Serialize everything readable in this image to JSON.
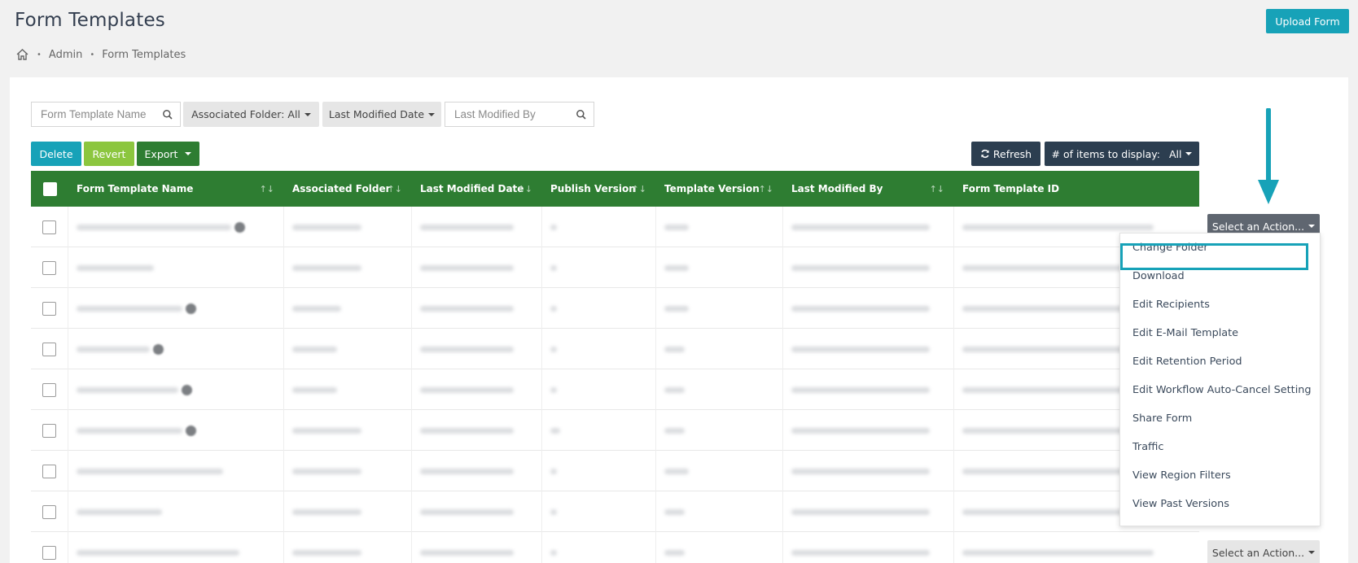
{
  "header": {
    "title": "Form Templates",
    "upload_label": "Upload Form",
    "breadcrumb": [
      "Admin",
      "Form Templates"
    ]
  },
  "filters": {
    "name_placeholder": "Form Template Name",
    "folder_label": "Associated Folder: All",
    "date_label": "Last Modified Date",
    "modified_by_placeholder": "Last Modified By"
  },
  "toolbar": {
    "delete_label": "Delete",
    "revert_label": "Revert",
    "export_label": "Export",
    "refresh_label": "Refresh",
    "items_label": "# of items to display:",
    "items_value": "All"
  },
  "table": {
    "columns": [
      "Form Template Name",
      "Associated Folder",
      "Last Modified Date",
      "Publish Version",
      "Template Version",
      "Last Modified By",
      "Form Template ID"
    ],
    "row_count": 9
  },
  "row_actions": {
    "button_label": "Select an Action...",
    "menu": [
      "Change Folder",
      "Download",
      "Edit Recipients",
      "Edit E-Mail Template",
      "Edit Retention Period",
      "Edit Workflow Auto-Cancel Setting",
      "Share Form",
      "Traffic",
      "View Region Filters",
      "View Past Versions"
    ]
  },
  "colors": {
    "teal": "#17a2b8",
    "green_header": "#2e7d32",
    "lime": "#8cc63f",
    "navy": "#2c3e50"
  }
}
